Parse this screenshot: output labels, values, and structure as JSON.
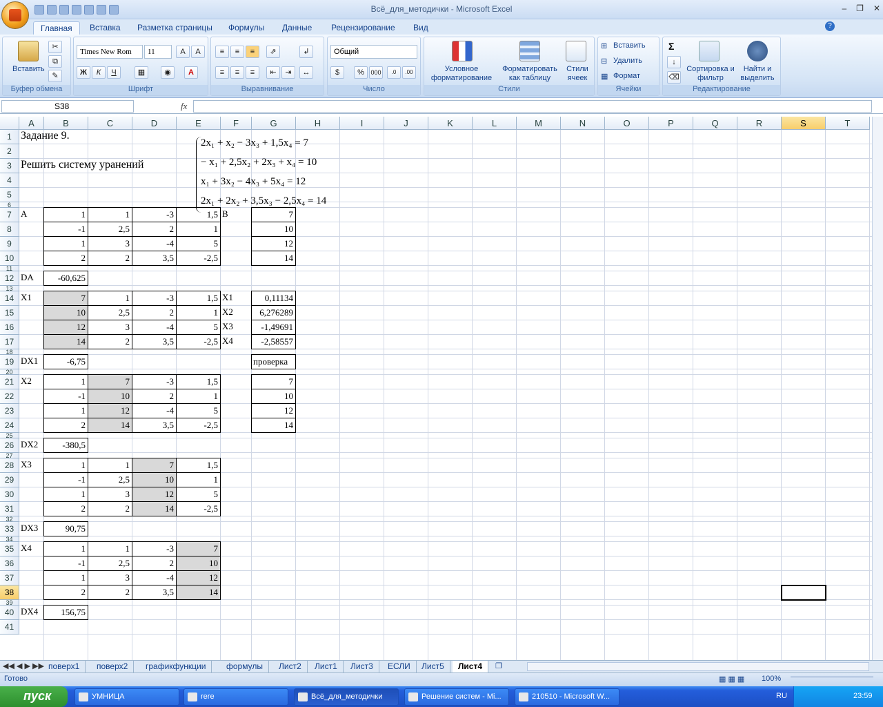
{
  "window": {
    "title": "Всё_для_методички - Microsoft Excel"
  },
  "ribbon_tabs": [
    "Главная",
    "Вставка",
    "Разметка страницы",
    "Формулы",
    "Данные",
    "Рецензирование",
    "Вид"
  ],
  "ribbon": {
    "paste_label": "Вставить",
    "clipboard_group": "Буфер обмена",
    "font_name": "Times New Rom",
    "font_size": "11",
    "font_group": "Шрифт",
    "bold": "Ж",
    "italic": "К",
    "underline": "Ч",
    "align_group": "Выравнивание",
    "number_format": "Общий",
    "number_group": "Число",
    "percent": "%",
    "thousands": "000",
    "cond_format": "Условное форматирование",
    "format_table": "Форматировать как таблицу",
    "cell_styles": "Стили ячеек",
    "styles_group": "Стили",
    "insert": "Вставить",
    "delete": "Удалить",
    "format": "Формат",
    "cells_group": "Ячейки",
    "sigma": "Σ",
    "sort_filter": "Сортировка и фильтр",
    "find_select": "Найти и выделить",
    "editing_group": "Редактирование"
  },
  "formula_bar": {
    "name_box": "S38",
    "fx": "fx",
    "formula": ""
  },
  "columns": [
    "A",
    "B",
    "C",
    "D",
    "E",
    "F",
    "G",
    "H",
    "I",
    "J",
    "K",
    "L",
    "M",
    "N",
    "O",
    "P",
    "Q",
    "R",
    "S",
    "T"
  ],
  "selected_column": "S",
  "rows": [
    "1",
    "2",
    "3",
    "4",
    "5",
    "6",
    "7",
    "8",
    "9",
    "10",
    "11",
    "12",
    "13",
    "14",
    "15",
    "16",
    "17",
    "18",
    "19",
    "20",
    "21",
    "22",
    "23",
    "24",
    "25",
    "26",
    "27",
    "28",
    "29",
    "30",
    "31",
    "32",
    "33",
    "34",
    "35",
    "36",
    "37",
    "38",
    "39",
    "40",
    "41"
  ],
  "selected_row": "38",
  "cells": {
    "A1": "Задание 9.",
    "A3": "Решить систему уранений",
    "A7": "A",
    "F7": "B",
    "B7": "1",
    "C7": "1",
    "D7": "-3",
    "E7": "1,5",
    "G7": "7",
    "B8": "-1",
    "C8": "2,5",
    "D8": "2",
    "E8": "1",
    "G8": "10",
    "B9": "1",
    "C9": "3",
    "D9": "-4",
    "E9": "5",
    "G9": "12",
    "B10": "2",
    "C10": "2",
    "D10": "3,5",
    "E10": "-2,5",
    "G10": "14",
    "A12": "DA",
    "B12": "-60,625",
    "A14": "X1",
    "B14": "7",
    "C14": "1",
    "D14": "-3",
    "E14": "1,5",
    "F14": "X1",
    "G14": "0,11134",
    "B15": "10",
    "C15": "2,5",
    "D15": "2",
    "E15": "1",
    "F15": "X2",
    "G15": "6,276289",
    "B16": "12",
    "C16": "3",
    "D16": "-4",
    "E16": "5",
    "F16": "X3",
    "G16": "-1,49691",
    "B17": "14",
    "C17": "2",
    "D17": "3,5",
    "E17": "-2,5",
    "F17": "X4",
    "G17": "-2,58557",
    "A19": "DX1",
    "B19": "-6,75",
    "G19": "проверка",
    "A21": "X2",
    "B21": "1",
    "C21": "7",
    "D21": "-3",
    "E21": "1,5",
    "G21": "7",
    "B22": "-1",
    "C22": "10",
    "D22": "2",
    "E22": "1",
    "G22": "10",
    "B23": "1",
    "C23": "12",
    "D23": "-4",
    "E23": "5",
    "G23": "12",
    "B24": "2",
    "C24": "14",
    "D24": "3,5",
    "E24": "-2,5",
    "G24": "14",
    "A26": "DX2",
    "B26": "-380,5",
    "A28": "X3",
    "B28": "1",
    "C28": "1",
    "D28": "7",
    "E28": "1,5",
    "B29": "-1",
    "C29": "2,5",
    "D29": "10",
    "E29": "1",
    "B30": "1",
    "C30": "3",
    "D30": "12",
    "E30": "5",
    "B31": "2",
    "C31": "2",
    "D31": "14",
    "E31": "-2,5",
    "A33": "DX3",
    "B33": "90,75",
    "A35": "X4",
    "B35": "1",
    "C35": "1",
    "D35": "-3",
    "E35": "7",
    "B36": "-1",
    "C36": "2,5",
    "D36": "2",
    "E36": "10",
    "B37": "1",
    "C37": "3",
    "D37": "-4",
    "E37": "12",
    "B38": "2",
    "C38": "2",
    "D38": "3,5",
    "E38": "14",
    "A40": "DX4",
    "B40": "156,75"
  },
  "equations": [
    "2x₁ + x₂ − 3x₃ + 1,5x₄ = 7",
    "− x₁ + 2,5x₂ + 2x₃ + x₄ = 10",
    "x₁ + 3x₂ − 4x₃ + 5x₄ = 12",
    "2x₁ + 2x₂ + 3,5x₃ − 2,5x₄ = 14"
  ],
  "sheet_tabs": [
    "поверх1",
    "поверх2",
    "графикфункции",
    "формулы",
    "Лист2",
    "Лист1",
    "Лист3",
    "ЕСЛИ",
    "Лист5",
    "Лист4"
  ],
  "active_sheet": "Лист4",
  "status": {
    "ready": "Готово",
    "zoom": "100%"
  },
  "taskbar": {
    "start": "пуск",
    "tasks": [
      "УМНИЦА",
      "rere",
      "Всё_для_методички",
      "Решение систем - Mi...",
      "210510 - Microsoft W..."
    ],
    "lang": "RU",
    "time": "23:59"
  }
}
